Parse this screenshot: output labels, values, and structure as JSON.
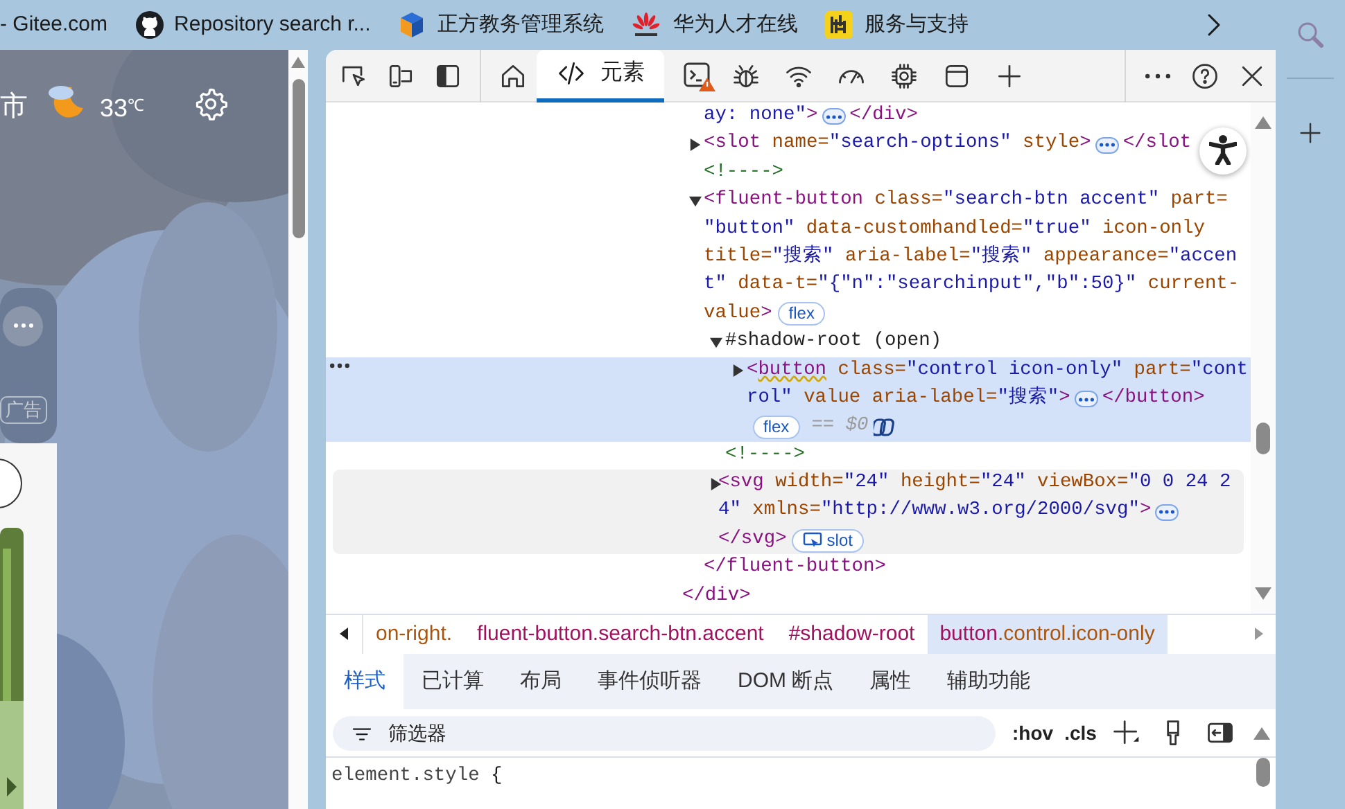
{
  "bookmarks": [
    {
      "label": "- Gitee.com"
    },
    {
      "label": "Repository search r..."
    },
    {
      "label": "正方教务管理系统"
    },
    {
      "label": "华为人才在线"
    },
    {
      "label": "服务与支持"
    }
  ],
  "page": {
    "city": "市",
    "temperature": "33",
    "unit": "℃",
    "ad_tag": "广告"
  },
  "devtools": {
    "tabs": [
      {
        "label": "元素",
        "selected": true
      }
    ],
    "dom_tree": {
      "children": [
        {
          "lines": [
            [
              {
                "kind": "value",
                "text": "ay: none\""
              },
              {
                "kind": "tag",
                "text": ">"
              },
              {
                "kind": "more"
              },
              {
                "kind": "tag",
                "text": "</div>"
              }
            ]
          ]
        },
        {
          "expanded": false,
          "lines": [
            [
              {
                "kind": "tag",
                "text": "<slot "
              },
              {
                "kind": "attr",
                "text": "name="
              },
              {
                "kind": "value",
                "text": "\"search-options\""
              },
              {
                "kind": "attr",
                "text": " style"
              },
              {
                "kind": "tag",
                "text": ">"
              },
              {
                "kind": "more"
              },
              {
                "kind": "tag",
                "text": "</slot"
              }
            ]
          ]
        },
        {
          "lines": [
            [
              {
                "kind": "comment",
                "text": "<!---->"
              }
            ]
          ]
        },
        {
          "expanded": true,
          "lines": [
            [
              {
                "kind": "tag",
                "text": "<fluent-button "
              },
              {
                "kind": "attr",
                "text": "class="
              },
              {
                "kind": "value",
                "text": "\"search-btn accent\""
              },
              {
                "kind": "attr",
                "text": " part="
              }
            ],
            [
              {
                "kind": "value",
                "text": "\"button\""
              },
              {
                "kind": "attr",
                "text": " data-customhandled="
              },
              {
                "kind": "value",
                "text": "\"true\""
              },
              {
                "kind": "attr",
                "text": " icon-only"
              }
            ],
            [
              {
                "kind": "attr",
                "text": "title="
              },
              {
                "kind": "value",
                "text": "\"搜索\""
              },
              {
                "kind": "attr",
                "text": " aria-label="
              },
              {
                "kind": "value",
                "text": "\"搜索\""
              },
              {
                "kind": "attr",
                "text": " appearance="
              },
              {
                "kind": "value",
                "text": "\"accen"
              }
            ],
            [
              {
                "kind": "value",
                "text": "t\""
              },
              {
                "kind": "attr",
                "text": " data-t="
              },
              {
                "kind": "value",
                "text": "\"{\"n\":\"searchinput\",\"b\":50}\""
              },
              {
                "kind": "attr",
                "text": " current-"
              }
            ],
            [
              {
                "kind": "attr",
                "text": "value"
              },
              {
                "kind": "tag",
                "text": ">"
              },
              {
                "kind": "badge",
                "text": "flex"
              }
            ]
          ],
          "children": [
            {
              "expanded": true,
              "lines": [
                [
                  {
                    "kind": "text",
                    "text": "#shadow-root (open)"
                  }
                ]
              ],
              "children": [
                {
                  "expanded": false,
                  "selected": true,
                  "lines": [
                    [
                      {
                        "kind": "tag",
                        "text": "<"
                      },
                      {
                        "kind": "flagged",
                        "text": "button"
                      },
                      {
                        "kind": "attr",
                        "text": " class="
                      },
                      {
                        "kind": "value",
                        "text": "\"control icon-only\""
                      },
                      {
                        "kind": "attr",
                        "text": " part="
                      },
                      {
                        "kind": "value",
                        "text": "\"cont"
                      }
                    ],
                    [
                      {
                        "kind": "value",
                        "text": "rol\""
                      },
                      {
                        "kind": "attr",
                        "text": " value aria-label="
                      },
                      {
                        "kind": "value",
                        "text": "\"搜索\""
                      },
                      {
                        "kind": "tag",
                        "text": ">"
                      },
                      {
                        "kind": "more"
                      },
                      {
                        "kind": "tag",
                        "text": "</button>"
                      }
                    ],
                    [
                      {
                        "kind": "badge",
                        "text": "flex"
                      },
                      {
                        "kind": "hint",
                        "text": "== $0"
                      },
                      {
                        "kind": "copilot"
                      }
                    ]
                  ]
                }
              ]
            },
            {
              "lines": [
                [
                  {
                    "kind": "comment",
                    "text": "<!---->"
                  }
                ]
              ]
            },
            {
              "expanded": false,
              "hovered": true,
              "lines": [
                [
                  {
                    "kind": "tag",
                    "text": "<svg "
                  },
                  {
                    "kind": "attr",
                    "text": "width="
                  },
                  {
                    "kind": "value",
                    "text": "\"24\""
                  },
                  {
                    "kind": "attr",
                    "text": " height="
                  },
                  {
                    "kind": "value",
                    "text": "\"24\""
                  },
                  {
                    "kind": "attr",
                    "text": " viewBox="
                  },
                  {
                    "kind": "value",
                    "text": "\"0 0 24 2"
                  }
                ],
                [
                  {
                    "kind": "value",
                    "text": "4\""
                  },
                  {
                    "kind": "attr",
                    "text": " xmlns="
                  },
                  {
                    "kind": "value",
                    "text": "\"http://www.w3.org/2000/svg\""
                  },
                  {
                    "kind": "tag",
                    "text": ">"
                  },
                  {
                    "kind": "more"
                  }
                ],
                [
                  {
                    "kind": "tag",
                    "text": "</svg>"
                  },
                  {
                    "kind": "slotbadge",
                    "text": "slot"
                  }
                ]
              ]
            }
          ],
          "closing": [
            [
              {
                "kind": "tag",
                "text": "</fluent-button>"
              }
            ]
          ]
        }
      ],
      "closing": [
        [
          {
            "kind": "tag",
            "text": "</div>"
          }
        ]
      ]
    },
    "breadcrumbs": [
      {
        "parts": [
          {
            "kind": "attr",
            "text": "on-right."
          }
        ],
        "selected": false
      },
      {
        "parts": [
          {
            "kind": "tag",
            "text": "fluent-button.search-btn.accent"
          }
        ],
        "selected": false
      },
      {
        "parts": [
          {
            "kind": "tag",
            "text": "#shadow-root"
          }
        ],
        "selected": false
      },
      {
        "parts": [
          {
            "kind": "tag",
            "text": "button"
          },
          {
            "kind": "attr",
            "text": ".control.icon-only"
          }
        ],
        "selected": true
      }
    ],
    "style_tabs": [
      {
        "label": "样式",
        "selected": true
      },
      {
        "label": "已计算",
        "selected": false
      },
      {
        "label": "布局",
        "selected": false
      },
      {
        "label": "事件侦听器",
        "selected": false
      },
      {
        "label": "DOM 断点",
        "selected": false
      },
      {
        "label": "属性",
        "selected": false
      },
      {
        "label": "辅助功能",
        "selected": false
      }
    ],
    "filter": {
      "placeholder": "筛选器"
    },
    "style_buttons": [
      ":hov",
      ".cls"
    ],
    "style_rule": "element.style {"
  }
}
